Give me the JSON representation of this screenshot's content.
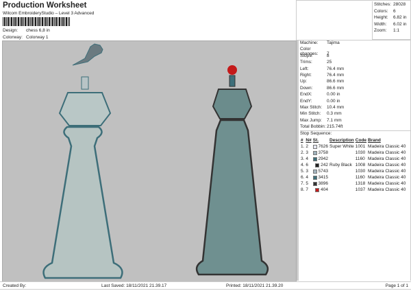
{
  "header": {
    "title": "Production Worksheet",
    "subtitle": "Wilcom EmbroideryStudio – Level 3 Advanced",
    "design_label": "Design:",
    "design_value": "chess 6,8 in",
    "colorway_label": "Colorway:",
    "colorway_value": "Colorway 1"
  },
  "summary": [
    {
      "k": "Stitches:",
      "v": "28028"
    },
    {
      "k": "Colors:",
      "v": "6"
    },
    {
      "k": "Height:",
      "v": "6.82 in"
    },
    {
      "k": "Width:",
      "v": "6.02 in"
    },
    {
      "k": "Zoom:",
      "v": "1:1"
    }
  ],
  "machine": [
    {
      "k": "Machine:",
      "v": "Tajima"
    },
    {
      "k": "Color changes:",
      "v": "7"
    },
    {
      "k": "Stops:",
      "v": "8"
    },
    {
      "k": "Trims:",
      "v": "25"
    },
    {
      "k": "Left:",
      "v": "76.4 mm"
    },
    {
      "k": "Right:",
      "v": "76.4 mm"
    },
    {
      "k": "Up:",
      "v": "86.6 mm"
    },
    {
      "k": "Down:",
      "v": "86.6 mm"
    },
    {
      "k": "EndX:",
      "v": "0.00 in"
    },
    {
      "k": "EndY:",
      "v": "0.00 in"
    },
    {
      "k": "Max Stitch:",
      "v": "10.4 mm"
    },
    {
      "k": "Min Stitch:",
      "v": "0.3 mm"
    },
    {
      "k": "Max Jump:",
      "v": "7.1 mm"
    },
    {
      "k": "Total Bobbin:",
      "v": "215.74ft"
    }
  ],
  "stop_sequence": {
    "title": "Stop Sequence:",
    "headers": [
      "#",
      "N#",
      "St.",
      "Description",
      "Code",
      "Brand"
    ],
    "rows": [
      {
        "i": "1.",
        "n": "2",
        "color": "#e6e8f2",
        "st": "7626",
        "desc": "Super White",
        "code": "1001",
        "brand": "Madeira Classic 40"
      },
      {
        "i": "2.",
        "n": "3",
        "color": "#9fb2bc",
        "st": "3758",
        "desc": "",
        "code": "1030",
        "brand": "Madeira Classic 40"
      },
      {
        "i": "3.",
        "n": "4",
        "color": "#3d6e79",
        "st": "2942",
        "desc": "",
        "code": "1160",
        "brand": "Madeira Classic 40"
      },
      {
        "i": "4.",
        "n": "6",
        "color": "#222222",
        "st": "242",
        "desc": "Ruby Black",
        "code": "1008",
        "brand": "Madeira Classic 40"
      },
      {
        "i": "5.",
        "n": "3",
        "color": "#a5b5be",
        "st": "5743",
        "desc": "",
        "code": "1030",
        "brand": "Madeira Classic 40"
      },
      {
        "i": "6.",
        "n": "4",
        "color": "#3e6f7a",
        "st": "3415",
        "desc": "",
        "code": "1160",
        "brand": "Madeira Classic 40"
      },
      {
        "i": "7.",
        "n": "5",
        "color": "#333333",
        "st": "3896",
        "desc": "",
        "code": "1318",
        "brand": "Madeira Classic 40"
      },
      {
        "i": "8.",
        "n": "7",
        "color": "#c41a1a",
        "st": "404",
        "desc": "",
        "code": "1037",
        "brand": "Madeira Classic 40"
      }
    ]
  },
  "footer": {
    "created": "Created By:",
    "saved": "Last Saved: 18/11/2021 21.39.17",
    "printed": "Printed: 18/11/2021 21.39.20",
    "page": "Page 1 of 1"
  }
}
